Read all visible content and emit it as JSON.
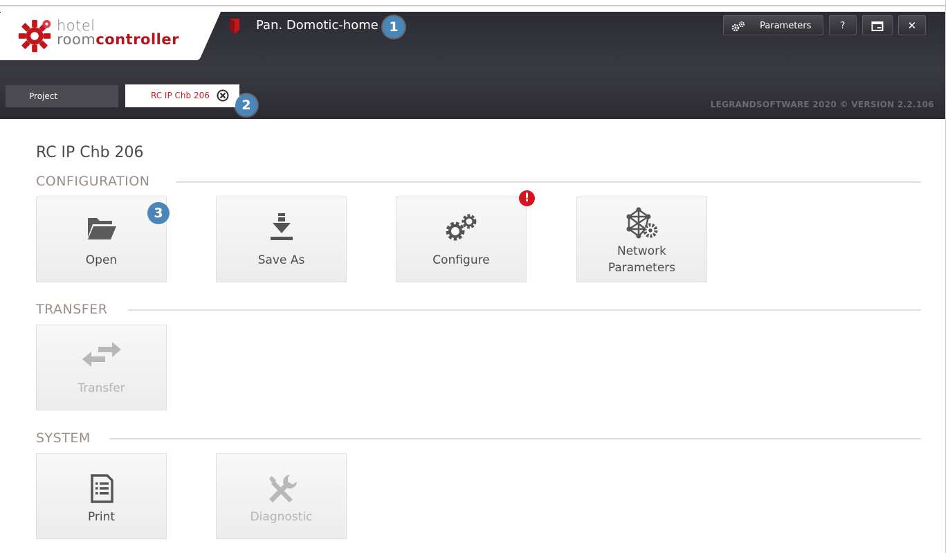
{
  "app": {
    "logo_line1": "hotel",
    "logo_line2_light": "room",
    "logo_line2_bold": "controller",
    "project_name": "Pan. Domotic-home",
    "version": "LEGRANDSOFTWARE 2020 © VERSION 2.2.106"
  },
  "header_buttons": {
    "parameters_label": "Parameters",
    "help_label": "?",
    "restore_icon": "window-restore-icon",
    "close_label": "✕"
  },
  "tabs": [
    {
      "label": "Project",
      "active": false
    },
    {
      "label": "RC IP Chb 206",
      "active": true
    }
  ],
  "badges": {
    "one": "1",
    "two": "2",
    "three": "3",
    "alert": "!"
  },
  "page": {
    "title": "RC IP Chb 206"
  },
  "sections": {
    "configuration": {
      "title": "CONFIGURATION",
      "tiles": [
        {
          "label": "Open",
          "icon": "folder-open-icon",
          "enabled": true
        },
        {
          "label": "Save As",
          "icon": "download-icon",
          "enabled": true
        },
        {
          "label": "Configure",
          "icon": "gears-icon",
          "enabled": true
        },
        {
          "label_line1": "Network",
          "label_line2": "Parameters",
          "icon": "network-gear-icon",
          "enabled": true
        }
      ]
    },
    "transfer": {
      "title": "TRANSFER",
      "tiles": [
        {
          "label": "Transfer",
          "icon": "transfer-arrows-icon",
          "enabled": false
        }
      ]
    },
    "system": {
      "title": "SYSTEM",
      "tiles": [
        {
          "label": "Print",
          "icon": "print-document-icon",
          "enabled": true
        },
        {
          "label": "Diagnostic",
          "icon": "tools-icon",
          "enabled": false
        }
      ]
    }
  },
  "colors": {
    "header_bg": "#33333a",
    "accent_red": "#c21f2a",
    "badge_blue": "#4a86b9",
    "section_title": "#9b8d86",
    "section_line": "#e8dcd5",
    "alert_red": "#d7141b"
  }
}
